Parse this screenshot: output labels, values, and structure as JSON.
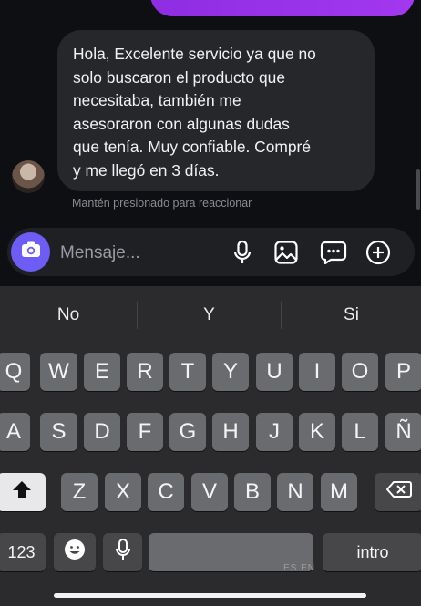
{
  "conversation": {
    "received_message": "Hola, Excelente servicio ya que no\nsolo buscaron el producto que\nnecesitaba, también me\nasesoraron con algunas dudas\nque tenía. Muy confiable. Compré\ny me llegó en 3 días.",
    "react_hint": "Mantén presionado para reaccionar",
    "sent_bubble_color": "#9b34ee"
  },
  "composer": {
    "placeholder": "Mensaje...",
    "accent": "#6e5cf6",
    "icons": [
      "camera-icon",
      "microphone-icon",
      "gallery-icon",
      "sticker-chat-icon",
      "add-icon"
    ]
  },
  "keyboard": {
    "suggestions": [
      "No",
      "Y",
      "Si"
    ],
    "row1": [
      "Q",
      "W",
      "E",
      "R",
      "T",
      "Y",
      "U",
      "I",
      "O",
      "P"
    ],
    "row2": [
      "A",
      "S",
      "D",
      "F",
      "G",
      "H",
      "J",
      "K",
      "L",
      "Ñ"
    ],
    "row3": [
      "Z",
      "X",
      "C",
      "V",
      "B",
      "N",
      "M"
    ],
    "numbers_key": "123",
    "return_key": "intro",
    "language_label": "ES EN",
    "icons": [
      "shift-icon",
      "backspace-icon",
      "emoji-icon",
      "dictation-icon"
    ]
  }
}
